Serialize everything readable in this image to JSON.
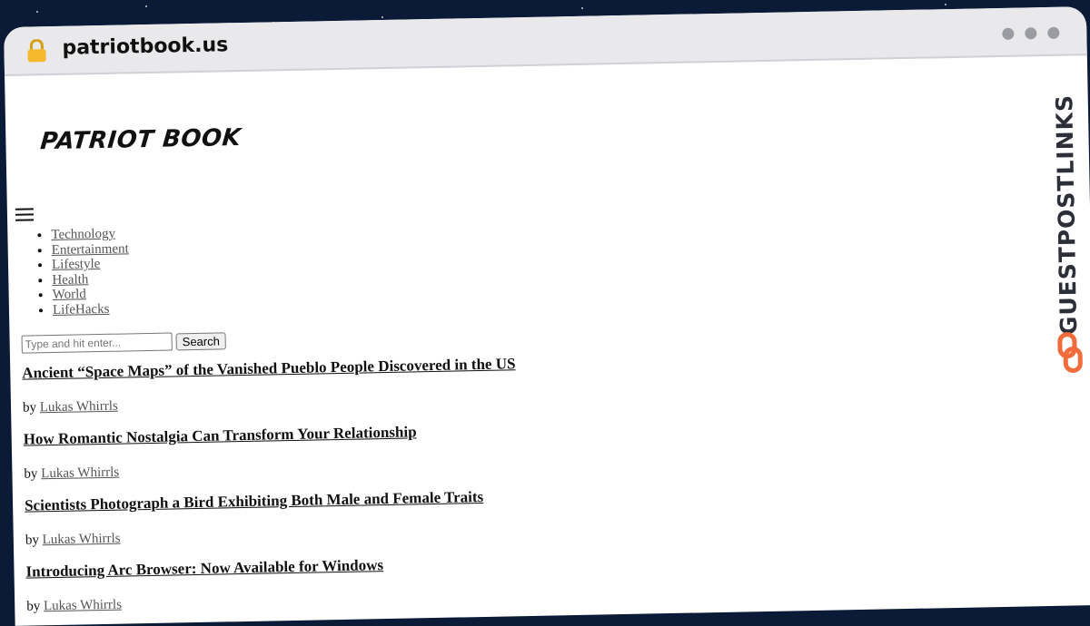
{
  "browser": {
    "url": "patriotbook.us",
    "icons": {
      "lock": "lock-icon",
      "window_controls": "window-dots-icon"
    }
  },
  "site": {
    "logo": "PATRIOT BOOK"
  },
  "nav": {
    "menu_icon": "hamburger-icon",
    "items": [
      "Technology",
      "Entertainment",
      "Lifestyle",
      "Health",
      "World",
      "LifeHacks"
    ]
  },
  "search": {
    "placeholder": "Type and hit enter...",
    "button_label": "Search"
  },
  "articles": [
    {
      "title": "Ancient “Space Maps” of the Vanished Pueblo People Discovered in the US",
      "by": "by",
      "author": "Lukas Whirrls"
    },
    {
      "title": "How Romantic Nostalgia Can Transform Your Relationship",
      "by": "by",
      "author": "Lukas Whirrls"
    },
    {
      "title": "Scientists Photograph a Bird Exhibiting Both Male and Female Traits",
      "by": "by",
      "author": "Lukas Whirrls"
    },
    {
      "title": "Introducing Arc Browser: Now Available for Windows",
      "by": "by",
      "author": "Lukas Whirrls"
    }
  ],
  "branding": {
    "side_text": "GUESTPOSTLINKS",
    "accent": "#f26b3a",
    "icon": "chain-link-icon"
  }
}
